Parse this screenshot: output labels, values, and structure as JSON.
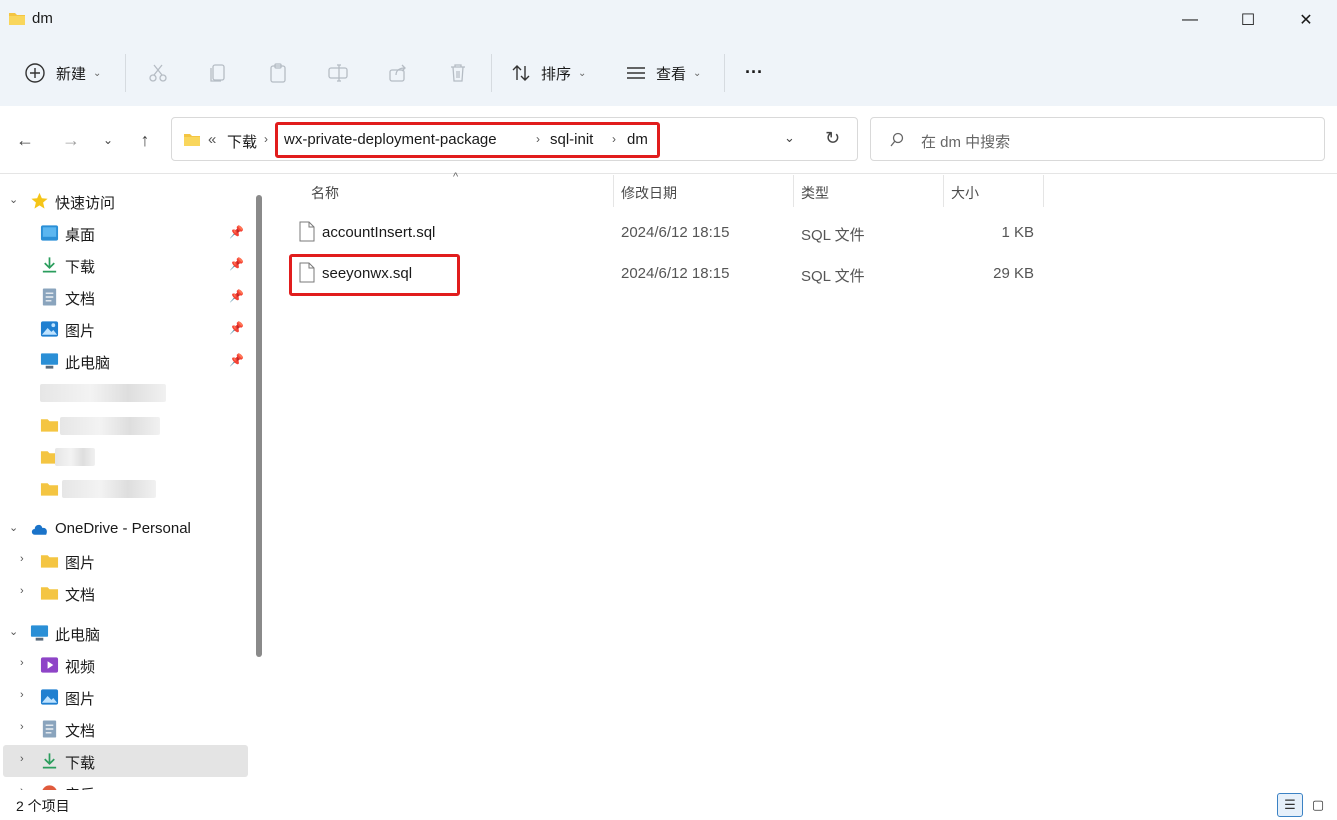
{
  "window": {
    "title": "dm",
    "minimize": "—",
    "maximize": "☐",
    "close": "✕"
  },
  "toolbar": {
    "new_label": "新建",
    "sort_label": "排序",
    "view_label": "查看",
    "more_label": "···"
  },
  "address": {
    "overflow": "«",
    "crumbs": [
      "下载",
      "wx-private-deployment-package",
      "sql-init",
      "dm"
    ]
  },
  "search": {
    "placeholder": "在 dm 中搜索"
  },
  "sidebar": {
    "quick_access": {
      "label": "快速访问",
      "items": [
        "桌面",
        "下载",
        "文档",
        "图片",
        "此电脑"
      ]
    },
    "onedrive": {
      "label": "OneDrive - Personal",
      "items": [
        "图片",
        "文档"
      ]
    },
    "this_pc": {
      "label": "此电脑",
      "items": [
        "视频",
        "图片",
        "文档",
        "下载",
        "音乐"
      ]
    }
  },
  "columns": {
    "name": "名称",
    "modified": "修改日期",
    "type": "类型",
    "size": "大小"
  },
  "files": [
    {
      "name": "accountInsert.sql",
      "modified": "2024/6/12 18:15",
      "type": "SQL 文件",
      "size": "1 KB"
    },
    {
      "name": "seeyonwx.sql",
      "modified": "2024/6/12 18:15",
      "type": "SQL 文件",
      "size": "29 KB"
    }
  ],
  "status": {
    "count": "2 个项目"
  },
  "colors": {
    "highlight": "#e11d1d",
    "chrome": "#eff4f9",
    "folder": "#f4c542",
    "accent": "#3b82c4"
  }
}
